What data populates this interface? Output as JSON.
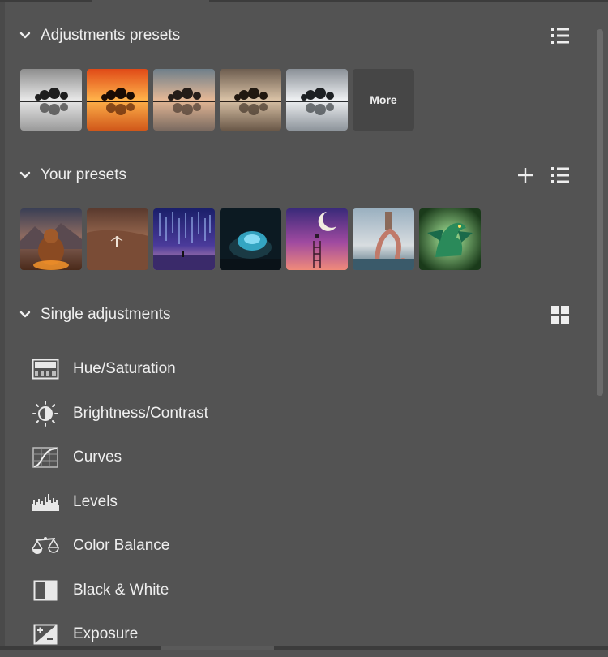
{
  "sections": {
    "adjustment_presets": {
      "title": "Adjustments presets",
      "more_label": "More",
      "presets": [
        {
          "icon": "bw-tree-reflection-thumbnail"
        },
        {
          "icon": "orange-sunset-tree-thumbnail"
        },
        {
          "icon": "warm-faded-tree-thumbnail"
        },
        {
          "icon": "sepia-tree-thumbnail"
        },
        {
          "icon": "cool-silver-tree-thumbnail"
        }
      ]
    },
    "your_presets": {
      "title": "Your presets",
      "presets": [
        {
          "icon": "bear-by-fire-thumbnail"
        },
        {
          "icon": "desert-figure-thumbnail"
        },
        {
          "icon": "starry-rain-thumbnail"
        },
        {
          "icon": "glowing-turtle-thumbnail"
        },
        {
          "icon": "moon-ladder-thumbnail"
        },
        {
          "icon": "octopus-lighthouse-thumbnail"
        },
        {
          "icon": "green-dragon-thumbnail"
        }
      ]
    },
    "single_adjustments": {
      "title": "Single adjustments",
      "items": [
        {
          "label": "Hue/Saturation",
          "icon": "hue-saturation-icon"
        },
        {
          "label": "Brightness/Contrast",
          "icon": "brightness-contrast-icon"
        },
        {
          "label": "Curves",
          "icon": "curves-icon"
        },
        {
          "label": "Levels",
          "icon": "levels-icon"
        },
        {
          "label": "Color Balance",
          "icon": "color-balance-icon"
        },
        {
          "label": "Black & White",
          "icon": "black-white-icon"
        },
        {
          "label": "Exposure",
          "icon": "exposure-icon"
        }
      ]
    }
  },
  "colors": {
    "panel_bg": "#535353",
    "text": "#efefef",
    "more_bg": "#464646"
  }
}
